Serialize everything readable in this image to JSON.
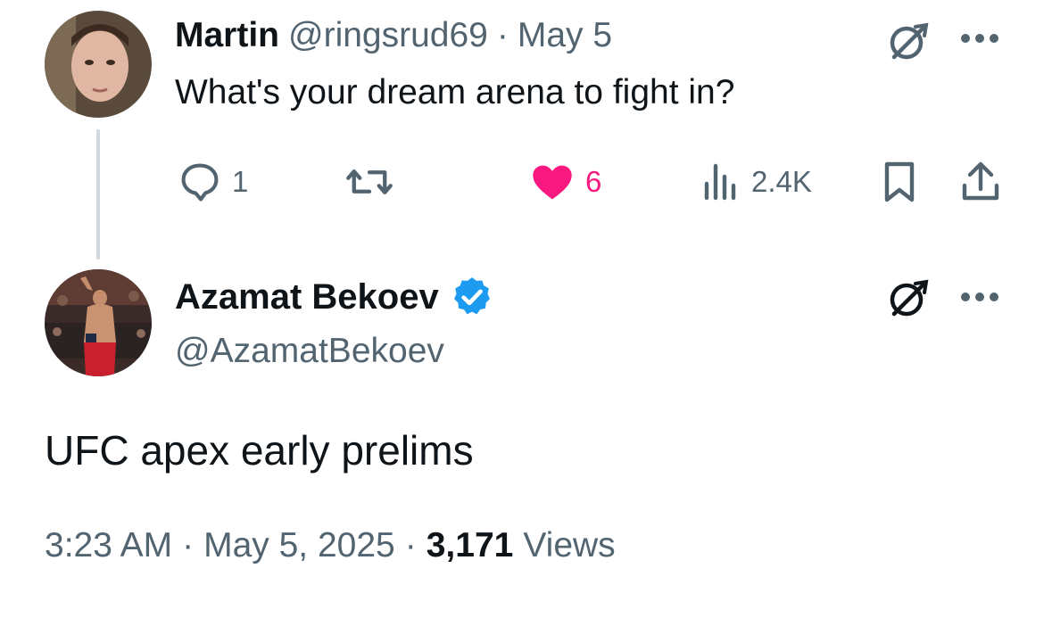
{
  "reply_to_tweet": {
    "author_name": "Martin",
    "handle": "@ringsrud69",
    "separator": "·",
    "date": "May 5",
    "text": "What's your dream arena to fight in?",
    "replies": "1",
    "retweets": "",
    "likes": "6",
    "views": "2.4K",
    "liked": true
  },
  "main_tweet": {
    "author_name": "Azamat Bekoev",
    "handle": "@AzamatBekoev",
    "verified": true,
    "text": "UFC apex early prelims",
    "time": "3:23 AM",
    "separator1": "·",
    "date": "May 5, 2025",
    "separator2": "·",
    "views_count": "3,171",
    "views_label": "Views"
  },
  "colors": {
    "text": "#0f1419",
    "muted": "#536471",
    "like": "#f91880",
    "verified": "#1d9bf0",
    "thread_line": "#cfd9de"
  },
  "icons": [
    "grok-icon",
    "more-icon",
    "reply-icon",
    "retweet-icon",
    "like-icon",
    "views-icon",
    "bookmark-icon",
    "share-icon",
    "verified-badge-icon"
  ]
}
